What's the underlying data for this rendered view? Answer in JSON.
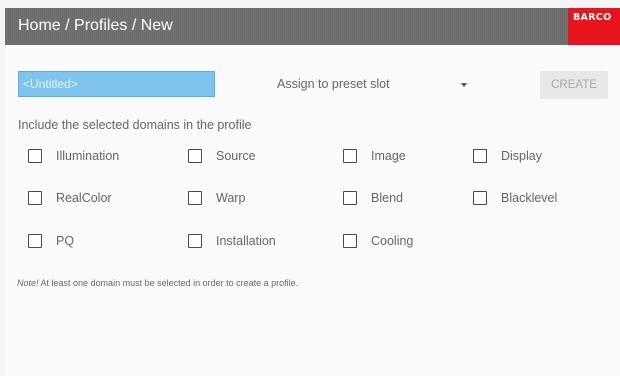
{
  "header": {
    "breadcrumb": "Home / Profiles / New",
    "brand": "BARCO"
  },
  "form": {
    "name_placeholder": "<Untitled>",
    "slot_label": "Assign to preset slot",
    "create_label": "CREATE",
    "include_label": "Include the selected domains in the profile"
  },
  "domains": [
    {
      "label": "Illumination",
      "checked": false
    },
    {
      "label": "Source",
      "checked": false
    },
    {
      "label": "Image",
      "checked": false
    },
    {
      "label": "Display",
      "checked": false
    },
    {
      "label": "RealColor",
      "checked": false
    },
    {
      "label": "Warp",
      "checked": false
    },
    {
      "label": "Blend",
      "checked": false
    },
    {
      "label": "Blacklevel",
      "checked": false
    },
    {
      "label": "PQ",
      "checked": false
    },
    {
      "label": "Installation",
      "checked": false
    },
    {
      "label": "Cooling",
      "checked": false
    }
  ],
  "note": {
    "prefix": "Note!",
    "text": " At least one domain must be selected in order to create a profile."
  }
}
